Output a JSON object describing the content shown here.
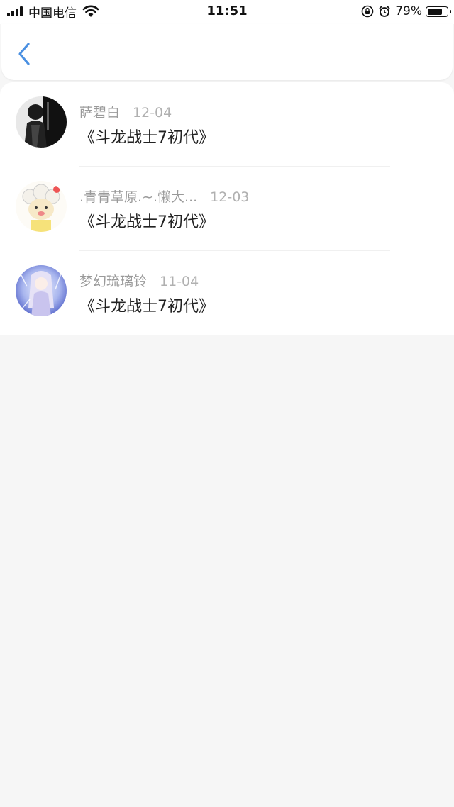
{
  "status_bar": {
    "carrier": "中国电信",
    "time": "11:51",
    "battery_percent": "79%",
    "battery_level": 0.79,
    "icons": [
      "signal-icon",
      "wifi-icon",
      "rotation-lock-icon",
      "alarm-icon",
      "battery-icon"
    ]
  },
  "header": {
    "back_icon": "chevron-left-icon",
    "accent_color": "#4a90e2"
  },
  "items": [
    {
      "name": "萨碧白",
      "date": "12-04",
      "title": "《斗龙战士7初代》",
      "avatar": "avatar-dark-figure"
    },
    {
      "name": ".青青草原.~.懒大...",
      "date": "12-03",
      "title": "《斗龙战士7初代》",
      "avatar": "avatar-sheep-cartoon"
    },
    {
      "name": "梦幻琉璃铃",
      "date": "11-04",
      "title": "《斗龙战士7初代》",
      "avatar": "avatar-anime-girl"
    }
  ]
}
